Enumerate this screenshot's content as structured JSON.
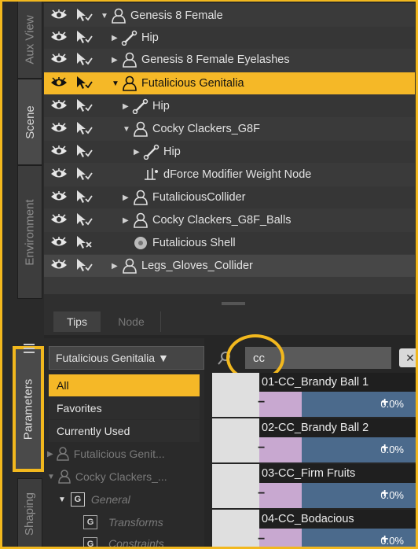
{
  "left_tabs": [
    "Aux View",
    "Scene",
    "Environment",
    "Parameters",
    "Shaping"
  ],
  "scene_tree": [
    {
      "label": "Genesis 8 Female",
      "icon": "figure-icon",
      "expand": "▼",
      "indent": 0
    },
    {
      "label": "Hip",
      "icon": "bone-icon",
      "expand": "▶",
      "indent": 1
    },
    {
      "label": "Genesis 8 Female Eyelashes",
      "icon": "figure-icon",
      "expand": "▶",
      "indent": 1
    },
    {
      "label": "Futalicious Genitalia",
      "icon": "figure-icon",
      "expand": "▼",
      "indent": 1
    },
    {
      "label": "Hip",
      "icon": "bone-icon",
      "expand": "▶",
      "indent": 2
    },
    {
      "label": "Cocky Clackers_G8F",
      "icon": "figure-icon",
      "expand": "▼",
      "indent": 2
    },
    {
      "label": "Hip",
      "icon": "bone-icon",
      "expand": "▶",
      "indent": 3
    },
    {
      "label": "dForce Modifier Weight Node",
      "icon": "weight-node-icon",
      "expand": "",
      "indent": 3
    },
    {
      "label": "FutaliciousCollider",
      "icon": "figure-icon",
      "expand": "▶",
      "indent": 2
    },
    {
      "label": "Cocky Clackers_G8F_Balls",
      "icon": "figure-icon",
      "expand": "▶",
      "indent": 2
    },
    {
      "label": "Futalicious Shell",
      "icon": "shell-icon",
      "expand": "",
      "indent": 2
    },
    {
      "label": "Legs_Gloves_Collider",
      "icon": "figure-icon",
      "expand": "▶",
      "indent": 1
    }
  ],
  "mid_tabs": [
    "Tips",
    "Node"
  ],
  "params": {
    "node_select": "Futalicious Genitalia ▼",
    "categories": [
      "All",
      "Favorites",
      "Currently Used",
      "Futalicious Genit...",
      "Cocky Clackers_...",
      "General",
      "Transforms",
      "Constraints"
    ],
    "search_value": "cc",
    "items": [
      {
        "name": "01-CC_Brandy Ball 1",
        "value": "0.0%"
      },
      {
        "name": "02-CC_Brandy Ball 2",
        "value": "0.0%"
      },
      {
        "name": "03-CC_Firm Fruits",
        "value": "0.0%"
      },
      {
        "name": "04-CC_Bodacious",
        "value": "0.0%"
      }
    ]
  },
  "colors": {
    "highlight": "#f5b827",
    "slider": "#4b6a8c",
    "frame": "#f2b81e"
  }
}
